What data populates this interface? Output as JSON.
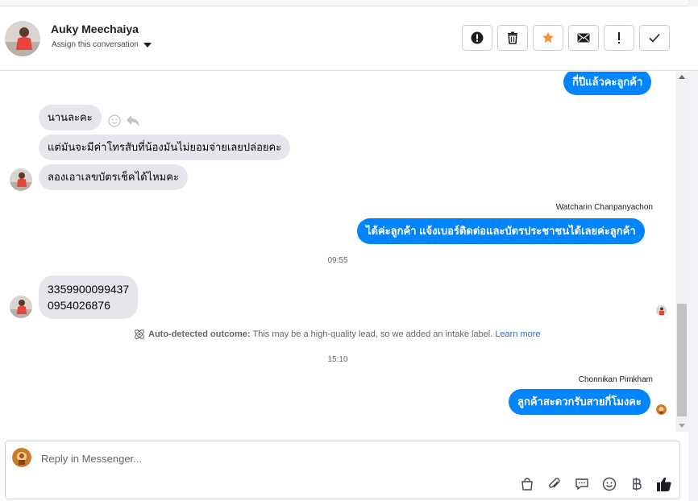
{
  "header": {
    "contact_name": "Auky Meechaiya",
    "assign_label": "Assign this conversation",
    "actions": [
      {
        "name": "spam-button",
        "icon": "alert-circle-icon"
      },
      {
        "name": "delete-button",
        "icon": "trash-icon"
      },
      {
        "name": "star-button",
        "icon": "star-icon"
      },
      {
        "name": "mark-unread-button",
        "icon": "envelope-icon"
      },
      {
        "name": "follow-up-button",
        "icon": "exclamation-icon"
      },
      {
        "name": "done-button",
        "icon": "checkmark-icon"
      }
    ]
  },
  "messages": {
    "out_1": "กี่ปีแล้วคะลูกค้า",
    "in_1": "นานละคะ",
    "in_2": "แต่มันจะมีค่าโทรสับที่น้องมันไม่ยอมจ่ายเลยปล่อยคะ",
    "in_3": "ลองเอาเลขบัตรเช็คได้ไหมคะ",
    "sender_1": "Watcharin Chanpanyachon",
    "out_2": "ได้ค่ะลูกค้า แจ้งเบอร์ติดต่อและบัตรประชาชนได้เลยค่ะลูกค้า",
    "time_1": "09:55",
    "in_4_line1": "3359900099437",
    "in_4_line2": "0954026876",
    "outcome_label": "Auto-detected outcome:",
    "outcome_text": "This may be a high-quality lead, so we added an intake label.",
    "outcome_link": "Learn more",
    "time_2": "15:10",
    "sender_2": "Chonnikan Pimkham",
    "out_3": "ลูกค้าสะดวกรับสายกี่โมงคะ"
  },
  "reply": {
    "placeholder": "Reply in Messenger..."
  },
  "colors": {
    "outgoing_bubble": "#0084ff",
    "incoming_bubble": "#e4e6eb",
    "star": "#f7923b",
    "link": "#216fdb"
  }
}
